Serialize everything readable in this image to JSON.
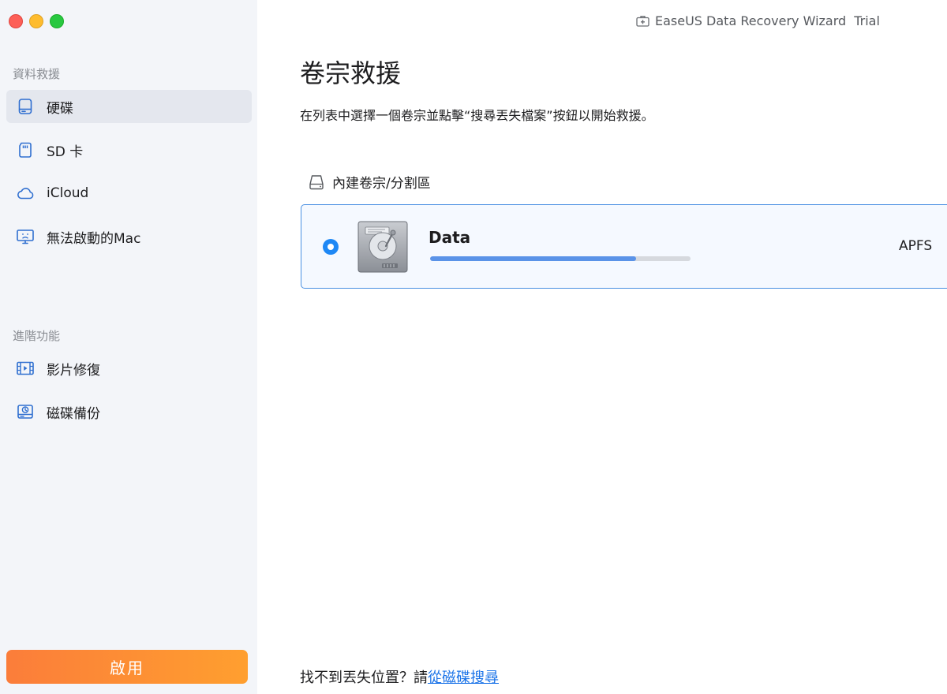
{
  "window": {
    "app_title": "EaseUS Data Recovery Wizard",
    "edition": "Trial"
  },
  "sidebar": {
    "section1_title": "資料救援",
    "items": [
      {
        "label": "硬碟",
        "icon": "hard-drive-icon",
        "active": true
      },
      {
        "label": "SD 卡",
        "icon": "sd-card-icon"
      },
      {
        "label": "iCloud",
        "icon": "cloud-icon"
      },
      {
        "label": "無法啟動的Mac",
        "icon": "unbootable-mac-icon"
      }
    ],
    "section2_title": "進階功能",
    "advanced_items": [
      {
        "label": "影片修復",
        "icon": "video-repair-icon"
      },
      {
        "label": "磁碟備份",
        "icon": "disk-backup-icon"
      }
    ],
    "activate_label": "啟用"
  },
  "main": {
    "title": "卷宗救援",
    "subtitle": "在列表中選擇一個卷宗並點擊“搜尋丟失檔案”按鈕以開始救援。",
    "group_label": "內建卷宗/分割區",
    "volume": {
      "name": "Data",
      "filesystem": "APFS",
      "usage_fraction": 0.79,
      "selected": true
    },
    "hint_text": "找不到丟失位置？請",
    "hint_link": "從磁碟搜尋"
  },
  "colors": {
    "accent": "#1e88f5",
    "activate_gradient_start": "#fb7d3a",
    "activate_gradient_end": "#ff9f2f",
    "link": "#1a73e8",
    "sidebar_bg": "#f3f5f9"
  }
}
